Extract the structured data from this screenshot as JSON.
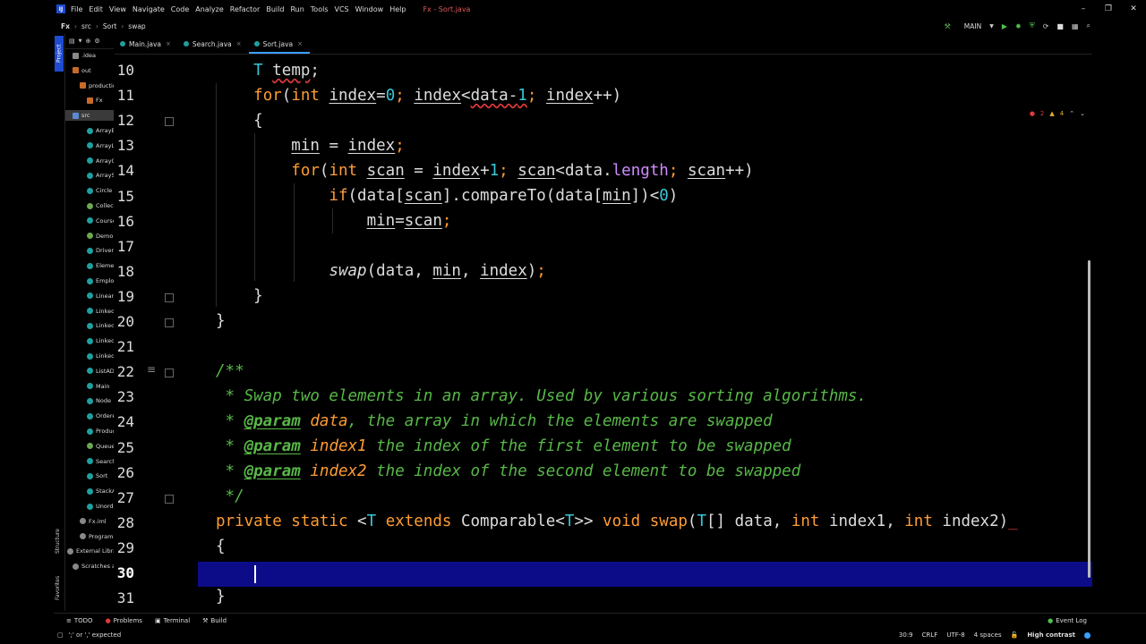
{
  "menu": {
    "logo": "IJ",
    "items": [
      "File",
      "Edit",
      "View",
      "Navigate",
      "Code",
      "Analyze",
      "Refactor",
      "Build",
      "Run",
      "Tools",
      "VCS",
      "Window",
      "Help"
    ],
    "window_title": "Fx - Sort.java"
  },
  "window_controls": {
    "minimize": "–",
    "restore": "❐",
    "close": "✕"
  },
  "nav": {
    "breadcrumbs": [
      "Fx",
      "src",
      "Sort",
      "swap"
    ],
    "run_config": "MAIN"
  },
  "project_panel": {
    "tab_label": "Project",
    "tree": [
      {
        "label": ".idea",
        "top": 0
      },
      {
        "label": "out"
      },
      {
        "label": "production"
      },
      {
        "label": "Fx"
      },
      {
        "label": "src"
      },
      {
        "label": "ArrayBag"
      },
      {
        "label": "ArrayList"
      },
      {
        "label": "ArrayQueue"
      },
      {
        "label": "ArrayStack"
      },
      {
        "label": "Circle"
      },
      {
        "label": "CollectionIface"
      },
      {
        "label": "Course"
      },
      {
        "label": "Demo"
      },
      {
        "label": "Driver"
      },
      {
        "label": "Element"
      },
      {
        "label": "Employee"
      },
      {
        "label": "LinearNode"
      },
      {
        "label": "LinkedBag"
      },
      {
        "label": "LinkedList"
      },
      {
        "label": "LinkedQueue"
      },
      {
        "label": "LinkedStack"
      },
      {
        "label": "ListADT"
      },
      {
        "label": "Main"
      },
      {
        "label": "Node"
      },
      {
        "label": "OrderedList"
      },
      {
        "label": "Product"
      },
      {
        "label": "QueueADT"
      },
      {
        "label": "Search"
      },
      {
        "label": "Sort"
      },
      {
        "label": "StackADT"
      },
      {
        "label": "UnorderedList"
      },
      {
        "label": "Fx.iml"
      },
      {
        "label": "Program"
      },
      {
        "label": "External Libraries"
      },
      {
        "label": "Scratches and Consoles"
      }
    ]
  },
  "side_tabs": {
    "structure": "Structure",
    "favorites": "Favorites"
  },
  "tabs": [
    {
      "label": "Main.java"
    },
    {
      "label": "Search.java"
    },
    {
      "label": "Sort.java"
    }
  ],
  "inspections": {
    "errors": "2",
    "warnings": "4"
  },
  "editor": {
    "line_numbers": [
      "10",
      "11",
      "12",
      "13",
      "14",
      "15",
      "16",
      "17",
      "18",
      "19",
      "20",
      "21",
      "22",
      "23",
      "24",
      "25",
      "26",
      "27",
      "28",
      "29",
      "30",
      "31"
    ],
    "current_line": "30"
  },
  "bottom_tools": [
    {
      "label": "TODO"
    },
    {
      "label": "Problems"
    },
    {
      "label": "Terminal"
    },
    {
      "label": "Build"
    }
  ],
  "event_log": "Event Log",
  "status": {
    "message": "';' or ',' expected",
    "position": "30:9",
    "line_sep": "CRLF",
    "encoding": "UTF-8",
    "indent": "4 spaces",
    "theme": "High contrast"
  }
}
